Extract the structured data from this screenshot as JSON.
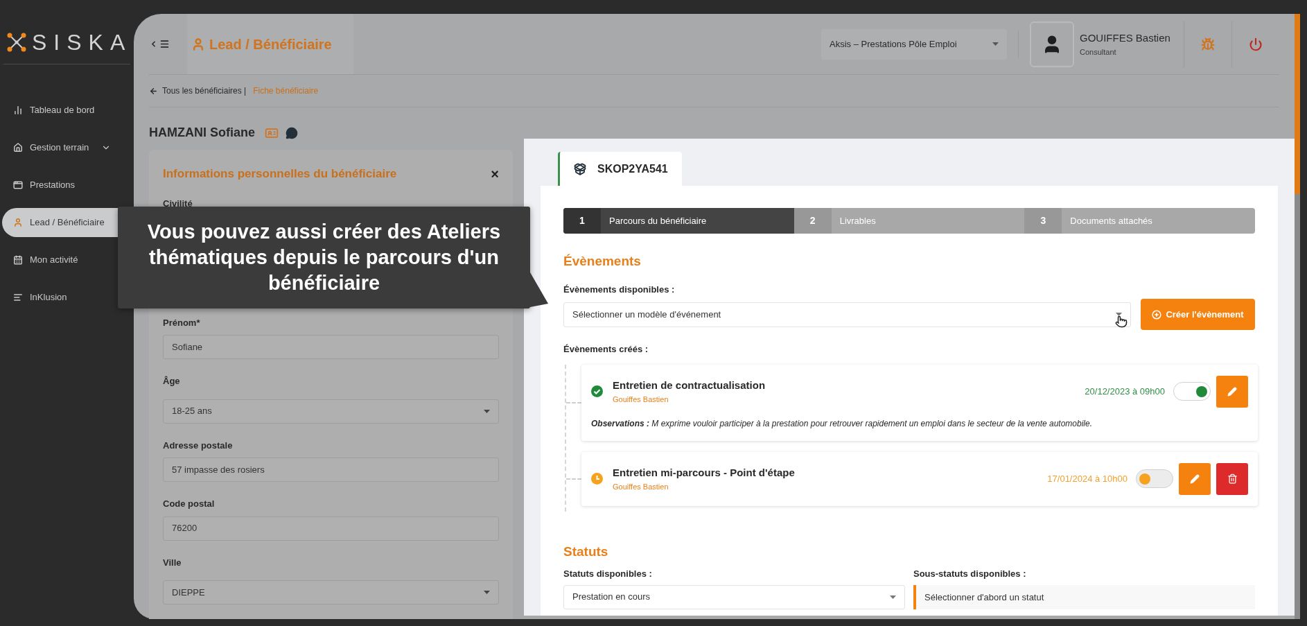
{
  "logo": {
    "text": "SISKA"
  },
  "sidebar": {
    "items": [
      {
        "label": "Tableau de bord",
        "kind": "link",
        "selected": false
      },
      {
        "label": "Gestion terrain",
        "kind": "group",
        "selected": false
      },
      {
        "label": "Prestations",
        "kind": "link",
        "selected": false
      },
      {
        "label": "Lead / Bénéficiaire",
        "kind": "link",
        "selected": true
      },
      {
        "label": "Mon activité",
        "kind": "link",
        "selected": false
      },
      {
        "label": "InKlusion",
        "kind": "link",
        "selected": false
      }
    ]
  },
  "header": {
    "page_title": "Lead / Bénéficiaire",
    "organization_select": {
      "value": "Aksis – Prestations Pôle Emploi"
    },
    "user": {
      "name": "GOUIFFES Bastien",
      "role": "Consultant"
    }
  },
  "breadcrumb": {
    "back": "Tous les bénéficiaires |",
    "current": "Fiche bénéficiaire"
  },
  "beneficiary_name": "HAMZANI Sofiane",
  "personal_info": {
    "title": "Informations personnelles du bénéficiaire",
    "close": "×",
    "fields": [
      {
        "label": "Civilité",
        "kind": "covered"
      },
      {
        "label": "Prénom*",
        "kind": "text",
        "value": "Sofiane"
      },
      {
        "label": "Âge",
        "kind": "select",
        "value": "18-25 ans"
      },
      {
        "label": "Adresse postale",
        "kind": "text",
        "value": "57 impasse des rosiers"
      },
      {
        "label": "Code postal",
        "kind": "text",
        "value": "76200"
      },
      {
        "label": "Ville",
        "kind": "select",
        "value": "DIEPPE"
      }
    ]
  },
  "callout": {
    "text": "Vous pouvez aussi créer des Ateliers thématiques depuis le parcours d'un bénéficiaire"
  },
  "file_panel": {
    "tab": "SKOP2YA541",
    "steps": [
      {
        "number": "1",
        "label": "Parcours du bénéficiaire",
        "selected": true
      },
      {
        "number": "2",
        "label": "Livrables",
        "selected": false
      },
      {
        "number": "3",
        "label": "Documents attachés",
        "selected": false
      }
    ],
    "events": {
      "title": "Évènements",
      "available_label": "Évènements disponibles :",
      "select_placeholder": "Sélectionner un modèle d'événement",
      "create_button": "Créer l'évènement",
      "created_label": "Évènements créés :",
      "items": [
        {
          "title": "Entretien de contractualisation",
          "author": "Gouiffes Bastien",
          "date": "20/12/2023 à 09h00",
          "completed": true,
          "on": true,
          "deletable": false,
          "observations": "**Observations :** M exprime vouloir participer à la prestation pour retrouver rapidement un emploi dans le secteur de la vente automobile."
        },
        {
          "title": "Entretien mi-parcours - Point d'étape",
          "author": "Gouiffes Bastien",
          "date": "17/01/2024 à 10h00",
          "completed": false,
          "on": false,
          "deletable": true
        }
      ]
    },
    "statuses": {
      "title": "Statuts",
      "available_label": "Statuts disponibles :",
      "value": "Prestation en cours",
      "sub_label": "Sous-statuts disponibles :",
      "sub_placeholder": "Sélectionner d'abord un statut"
    }
  }
}
